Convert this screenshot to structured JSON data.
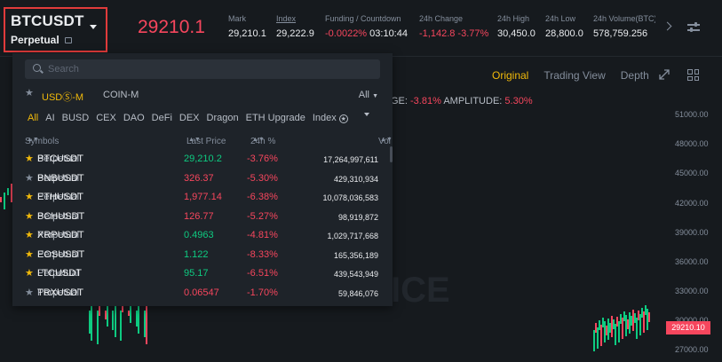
{
  "symbol": {
    "name": "BTCUSDT",
    "type": "Perpetual"
  },
  "last_price": "29210.1",
  "stats": [
    {
      "label": "Mark",
      "value": "29,210.1",
      "underline": false,
      "color": ""
    },
    {
      "label": "Index",
      "value": "29,222.9",
      "underline": true,
      "color": ""
    },
    {
      "label": "Funding / Countdown",
      "value": "-0.0022%",
      "value2": "03:10:44",
      "underline": false,
      "color": "red"
    },
    {
      "label": "24h Change",
      "value": "-1,142.8 -3.77%",
      "underline": false,
      "color": "red"
    },
    {
      "label": "24h High",
      "value": "30,450.0",
      "underline": false,
      "color": ""
    },
    {
      "label": "24h Low",
      "value": "28,800.0",
      "underline": false,
      "color": ""
    },
    {
      "label": "24h Volume(BTC)",
      "value": "578,759.256",
      "underline": false,
      "color": ""
    }
  ],
  "chart_tabs": [
    "Original",
    "Trading View",
    "Depth"
  ],
  "chart_change": {
    "label_change": "GE:",
    "change": "-3.81%",
    "label_amp": "AMPLITUDE:",
    "amp": "5.30%"
  },
  "y_ticks": [
    "51000.00",
    "48000.00",
    "45000.00",
    "42000.00",
    "39000.00",
    "36000.00",
    "33000.00",
    "30000.00",
    "27000.00"
  ],
  "current_price_tag": "29210.10",
  "watermark": "ICE",
  "search": {
    "placeholder": "Search"
  },
  "markets": {
    "usd": "USDⓈ-M",
    "coin": "COIN-M",
    "all": "All"
  },
  "categories": [
    "All",
    "AI",
    "BUSD",
    "CEX",
    "DAO",
    "DeFi",
    "DEX",
    "Dragon",
    "ETH Upgrade",
    "Index"
  ],
  "columns": {
    "symbols": "Symbols",
    "last_price": "Last Price",
    "change": "24h %",
    "vol": "Vol"
  },
  "rows": [
    {
      "symbol": "BTCUSDT",
      "type": "Perpetual",
      "price": "29,210.2",
      "price_color": "green",
      "change": "-3.76%",
      "vol": "17,264,997,611",
      "fav": true
    },
    {
      "symbol": "BNBUSDT",
      "type": "Perpetual",
      "price": "326.37",
      "price_color": "red",
      "change": "-5.30%",
      "vol": "429,310,934",
      "fav": false
    },
    {
      "symbol": "ETHUSDT",
      "type": "Perpetual",
      "price": "1,977.14",
      "price_color": "red",
      "change": "-6.38%",
      "vol": "10,078,036,583",
      "fav": true
    },
    {
      "symbol": "BCHUSDT",
      "type": "Perpetual",
      "price": "126.77",
      "price_color": "red",
      "change": "-5.27%",
      "vol": "98,919,872",
      "fav": true
    },
    {
      "symbol": "XRPUSDT",
      "type": "Perpetual",
      "price": "0.4963",
      "price_color": "green",
      "change": "-4.81%",
      "vol": "1,029,717,668",
      "fav": true
    },
    {
      "symbol": "EOSUSDT",
      "type": "Perpetual",
      "price": "1.122",
      "price_color": "green",
      "change": "-8.33%",
      "vol": "165,356,189",
      "fav": true
    },
    {
      "symbol": "LTCUSDT",
      "type": "Perpetual",
      "price": "95.17",
      "price_color": "green",
      "change": "-6.51%",
      "vol": "439,543,949",
      "fav": true
    },
    {
      "symbol": "TRXUSDT",
      "type": "Perpetual",
      "price": "0.06547",
      "price_color": "red",
      "change": "-1.70%",
      "vol": "59,846,076",
      "fav": false
    }
  ],
  "colors": {
    "up": "#0ecb81",
    "down": "#f6465d",
    "accent": "#f0b90b",
    "highlight_box": "#e03b3b"
  }
}
